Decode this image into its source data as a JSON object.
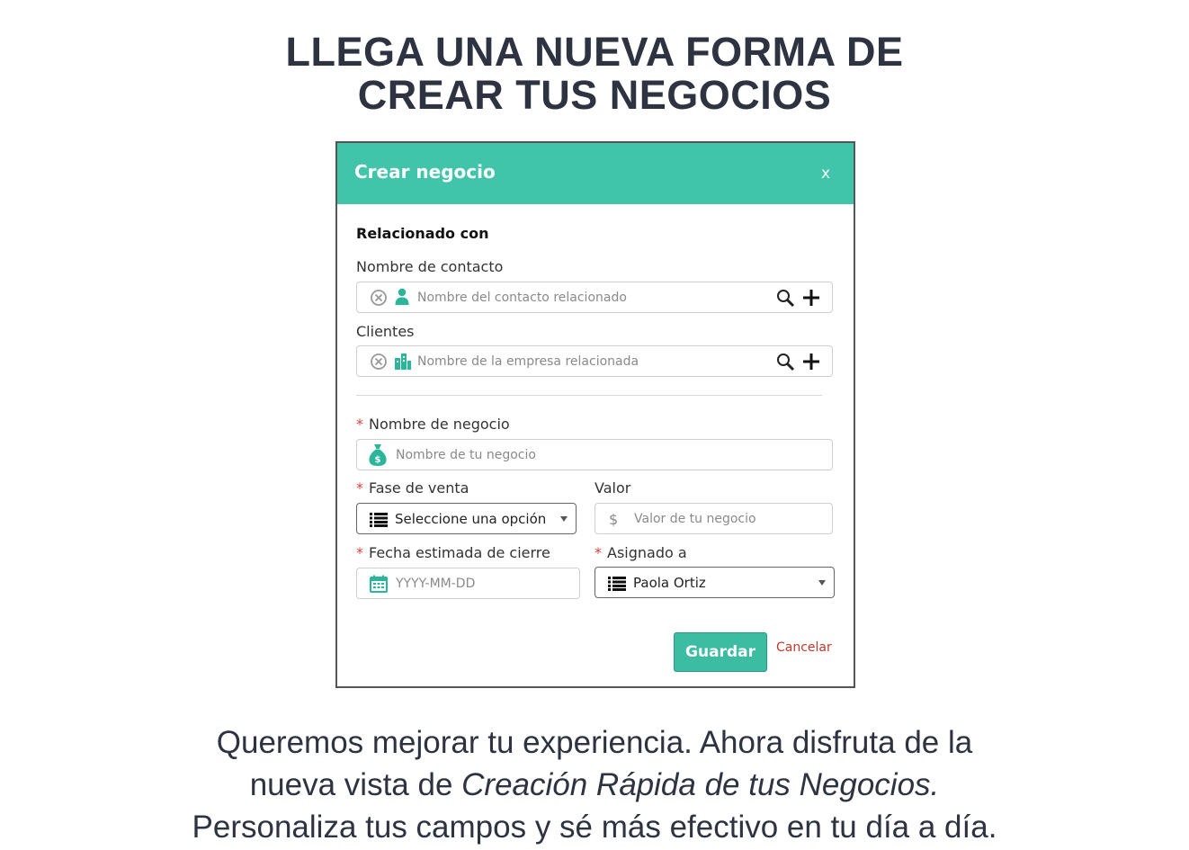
{
  "headline": {
    "line1": "LLEGA UNA NUEVA FORMA DE",
    "line2": "CREAR TUS NEGOCIOS"
  },
  "modal": {
    "title": "Crear negocio",
    "close_label": "x",
    "section_title": "Relacionado con",
    "contact": {
      "label": "Nombre de contacto",
      "placeholder": "Nombre del contacto relacionado",
      "icons": [
        "clear-icon",
        "person-icon",
        "search-icon",
        "plus-icon"
      ]
    },
    "clients": {
      "label": "Clientes",
      "placeholder": "Nombre de la empresa relacionada",
      "icons": [
        "clear-icon",
        "building-icon",
        "search-icon",
        "plus-icon"
      ]
    },
    "deal_name": {
      "required_mark": "*",
      "label": "Nombre de negocio",
      "placeholder": "Nombre de tu negocio",
      "icon": "money-bag-icon"
    },
    "stage": {
      "required_mark": "*",
      "label": "Fase de venta",
      "value": "Seleccione una opción",
      "icon": "list-icon"
    },
    "amount": {
      "label": "Valor",
      "currency": "$",
      "placeholder": "Valor de tu negocio"
    },
    "close_date": {
      "required_mark": "*",
      "label": "Fecha estimada de cierre",
      "placeholder": "YYYY-MM-DD",
      "icon": "calendar-icon"
    },
    "assignee": {
      "required_mark": "*",
      "label": "Asignado a",
      "value": "Paola Ortiz",
      "icon": "list-icon"
    },
    "save_label": "Guardar",
    "cancel_label": "Cancelar"
  },
  "footer": {
    "line1": "Queremos mejorar tu experiencia. Ahora disfruta de la",
    "line2_prefix": "nueva vista de ",
    "line2_italic": "Creación Rápida de tus Negocios.",
    "line3": "Personaliza tus campos y sé más efectivo en tu día a día."
  },
  "colors": {
    "accent": "#40c4aa",
    "required": "#d9403a",
    "cancel": "#c0392b",
    "headline": "#2d3340"
  }
}
